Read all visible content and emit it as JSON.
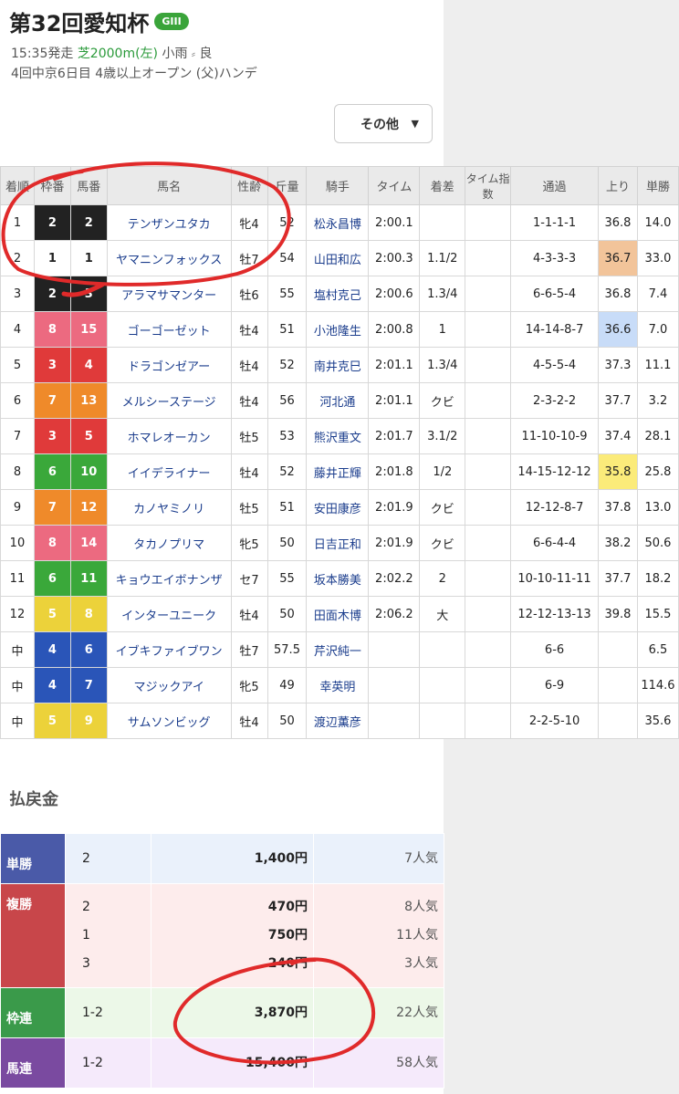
{
  "race": {
    "title": "第32回愛知杯",
    "grade": "GIII",
    "time": "15:35発走",
    "course": "芝2000m(左)",
    "weather": "小雨",
    "condition": "良",
    "meeting": "4回中京6日目 4歳以上オープン (父)ハンデ"
  },
  "sort_button": {
    "label": "その他"
  },
  "table": {
    "headers": [
      "着順",
      "枠番",
      "馬番",
      "馬名",
      "性齢",
      "斤量",
      "騎手",
      "タイム",
      "着差",
      "タイム指数",
      "通過",
      "上り",
      "単勝"
    ],
    "rows": [
      {
        "pos": "1",
        "waku": "2",
        "uma": "2",
        "name": "テンザンユタカ",
        "sex": "牝4",
        "kin": "52",
        "jockey": "松永昌博",
        "time": "2:00.1",
        "margin": "",
        "idx": "",
        "pass": "1-1-1-1",
        "last": "36.8",
        "odds": "14.0"
      },
      {
        "pos": "2",
        "waku": "1",
        "uma": "1",
        "name": "ヤマニンフォックス",
        "sex": "牡7",
        "kin": "54",
        "jockey": "山田和広",
        "time": "2:00.3",
        "margin": "1.1/2",
        "idx": "",
        "pass": "4-3-3-3",
        "last": "36.7",
        "odds": "33.0"
      },
      {
        "pos": "3",
        "waku": "2",
        "uma": "3",
        "name": "アラマサマンター",
        "sex": "牡6",
        "kin": "55",
        "jockey": "塩村克己",
        "time": "2:00.6",
        "margin": "1.3/4",
        "idx": "",
        "pass": "6-6-5-4",
        "last": "36.8",
        "odds": "7.4"
      },
      {
        "pos": "4",
        "waku": "8",
        "uma": "15",
        "name": "ゴーゴーゼット",
        "sex": "牡4",
        "kin": "51",
        "jockey": "小池隆生",
        "time": "2:00.8",
        "margin": "1",
        "idx": "",
        "pass": "14-14-8-7",
        "last": "36.6",
        "odds": "7.0"
      },
      {
        "pos": "5",
        "waku": "3",
        "uma": "4",
        "name": "ドラゴンゼアー",
        "sex": "牡4",
        "kin": "52",
        "jockey": "南井克巳",
        "time": "2:01.1",
        "margin": "1.3/4",
        "idx": "",
        "pass": "4-5-5-4",
        "last": "37.3",
        "odds": "11.1"
      },
      {
        "pos": "6",
        "waku": "7",
        "uma": "13",
        "name": "メルシーステージ",
        "sex": "牡4",
        "kin": "56",
        "jockey": "河北通",
        "time": "2:01.1",
        "margin": "クビ",
        "idx": "",
        "pass": "2-3-2-2",
        "last": "37.7",
        "odds": "3.2"
      },
      {
        "pos": "7",
        "waku": "3",
        "uma": "5",
        "name": "ホマレオーカン",
        "sex": "牡5",
        "kin": "53",
        "jockey": "熊沢重文",
        "time": "2:01.7",
        "margin": "3.1/2",
        "idx": "",
        "pass": "11-10-10-9",
        "last": "37.4",
        "odds": "28.1"
      },
      {
        "pos": "8",
        "waku": "6",
        "uma": "10",
        "name": "イイデライナー",
        "sex": "牡4",
        "kin": "52",
        "jockey": "藤井正輝",
        "time": "2:01.8",
        "margin": "1/2",
        "idx": "",
        "pass": "14-15-12-12",
        "last": "35.8",
        "odds": "25.8"
      },
      {
        "pos": "9",
        "waku": "7",
        "uma": "12",
        "name": "カノヤミノリ",
        "sex": "牡5",
        "kin": "51",
        "jockey": "安田康彦",
        "time": "2:01.9",
        "margin": "クビ",
        "idx": "",
        "pass": "12-12-8-7",
        "last": "37.8",
        "odds": "13.0"
      },
      {
        "pos": "10",
        "waku": "8",
        "uma": "14",
        "name": "タカノプリマ",
        "sex": "牝5",
        "kin": "50",
        "jockey": "日吉正和",
        "time": "2:01.9",
        "margin": "クビ",
        "idx": "",
        "pass": "6-6-4-4",
        "last": "38.2",
        "odds": "50.6"
      },
      {
        "pos": "11",
        "waku": "6",
        "uma": "11",
        "name": "キョウエイボナンザ",
        "sex": "セ7",
        "kin": "55",
        "jockey": "坂本勝美",
        "time": "2:02.2",
        "margin": "2",
        "idx": "",
        "pass": "10-10-11-11",
        "last": "37.7",
        "odds": "18.2"
      },
      {
        "pos": "12",
        "waku": "5",
        "uma": "8",
        "name": "インターユニーク",
        "sex": "牡4",
        "kin": "50",
        "jockey": "田面木博",
        "time": "2:06.2",
        "margin": "大",
        "idx": "",
        "pass": "12-12-13-13",
        "last": "39.8",
        "odds": "15.5"
      },
      {
        "pos": "中",
        "waku": "4",
        "uma": "6",
        "name": "イブキファイブワン",
        "sex": "牡7",
        "kin": "57.5",
        "jockey": "芹沢純一",
        "time": "",
        "margin": "",
        "idx": "",
        "pass": "6-6",
        "last": "",
        "odds": "6.5"
      },
      {
        "pos": "中",
        "waku": "4",
        "uma": "7",
        "name": "マジックアイ",
        "sex": "牝5",
        "kin": "49",
        "jockey": "幸英明",
        "time": "",
        "margin": "",
        "idx": "",
        "pass": "6-9",
        "last": "",
        "odds": "114.6"
      },
      {
        "pos": "中",
        "waku": "5",
        "uma": "9",
        "name": "サムソンビッグ",
        "sex": "牡4",
        "kin": "50",
        "jockey": "渡辺薫彦",
        "time": "",
        "margin": "",
        "idx": "",
        "pass": "2-2-5-10",
        "last": "",
        "odds": "35.6"
      }
    ],
    "last_highlight": {
      "1": "#f2c49a",
      "3": "#c8dcf8",
      "7": "#fbeb7a"
    }
  },
  "waku_colors": {
    "1": {
      "bg": "#ffffff",
      "fg": "#222222"
    },
    "2": {
      "bg": "#222222",
      "fg": "#ffffff"
    },
    "3": {
      "bg": "#e03a3a",
      "fg": "#ffffff"
    },
    "4": {
      "bg": "#2a55b8",
      "fg": "#ffffff"
    },
    "5": {
      "bg": "#ecd23a",
      "fg": "#ffffff"
    },
    "6": {
      "bg": "#3aa83a",
      "fg": "#ffffff"
    },
    "7": {
      "bg": "#ef8a2a",
      "fg": "#ffffff"
    },
    "8": {
      "bg": "#ec6a80",
      "fg": "#ffffff"
    }
  },
  "payout": {
    "title": "払戻金",
    "rows": [
      {
        "label": "単勝",
        "color": "#4a5aa8",
        "bg": "#eaf1fb",
        "nums": [
          "2"
        ],
        "amounts": [
          "1,400円"
        ],
        "pops": [
          "7人気"
        ]
      },
      {
        "label": "複勝",
        "color": "#c8464a",
        "bg": "#fdecec",
        "nums": [
          "2",
          "1",
          "3"
        ],
        "amounts": [
          "470円",
          "750円",
          "240円"
        ],
        "pops": [
          "8人気",
          "11人気",
          "3人気"
        ]
      },
      {
        "label": "枠連",
        "color": "#3a9a4a",
        "bg": "#ecf8e8",
        "nums": [
          "1-2"
        ],
        "amounts": [
          "3,870円"
        ],
        "pops": [
          "22人気"
        ]
      },
      {
        "label": "馬連",
        "color": "#7a4aa0",
        "bg": "#f5eafb",
        "nums": [
          "1-2"
        ],
        "amounts": [
          "15,400円"
        ],
        "pops": [
          "58人気"
        ]
      }
    ]
  }
}
